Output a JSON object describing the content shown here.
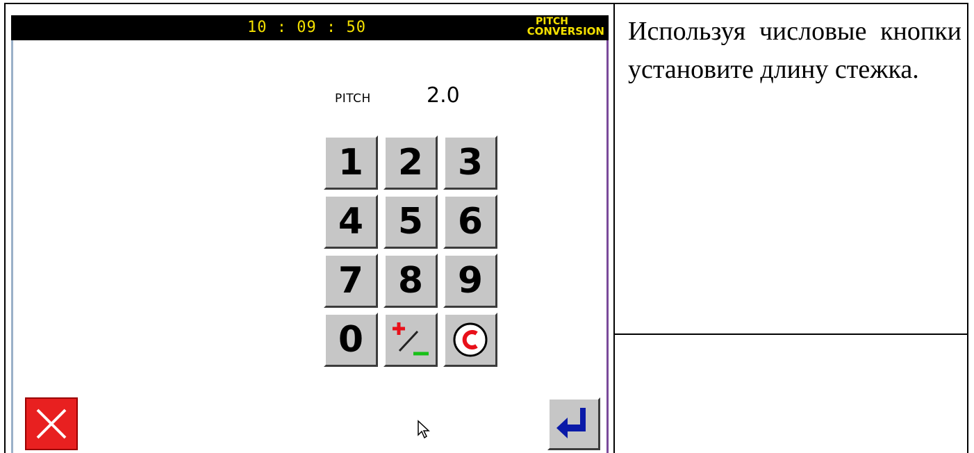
{
  "panel": {
    "clock": "10 : 09 : 50",
    "mode_line1": "PITCH",
    "mode_line2": "CONVERSION",
    "pitch_label": "PITCH",
    "pitch_value": "2.0",
    "keypad": [
      "1",
      "2",
      "3",
      "4",
      "5",
      "6",
      "7",
      "8",
      "9",
      "0"
    ],
    "colors": {
      "titlebar": "#000000",
      "title_text": "#f5e100",
      "cancel": "#e82020",
      "enter_arrow": "#0a1aa8"
    }
  },
  "instruction": {
    "text": "Используя числовые кнопки установите длину стежка."
  },
  "icons": [
    "close-icon",
    "enter-icon",
    "plus-minus-icon",
    "clear-icon",
    "mouse-cursor-icon"
  ]
}
